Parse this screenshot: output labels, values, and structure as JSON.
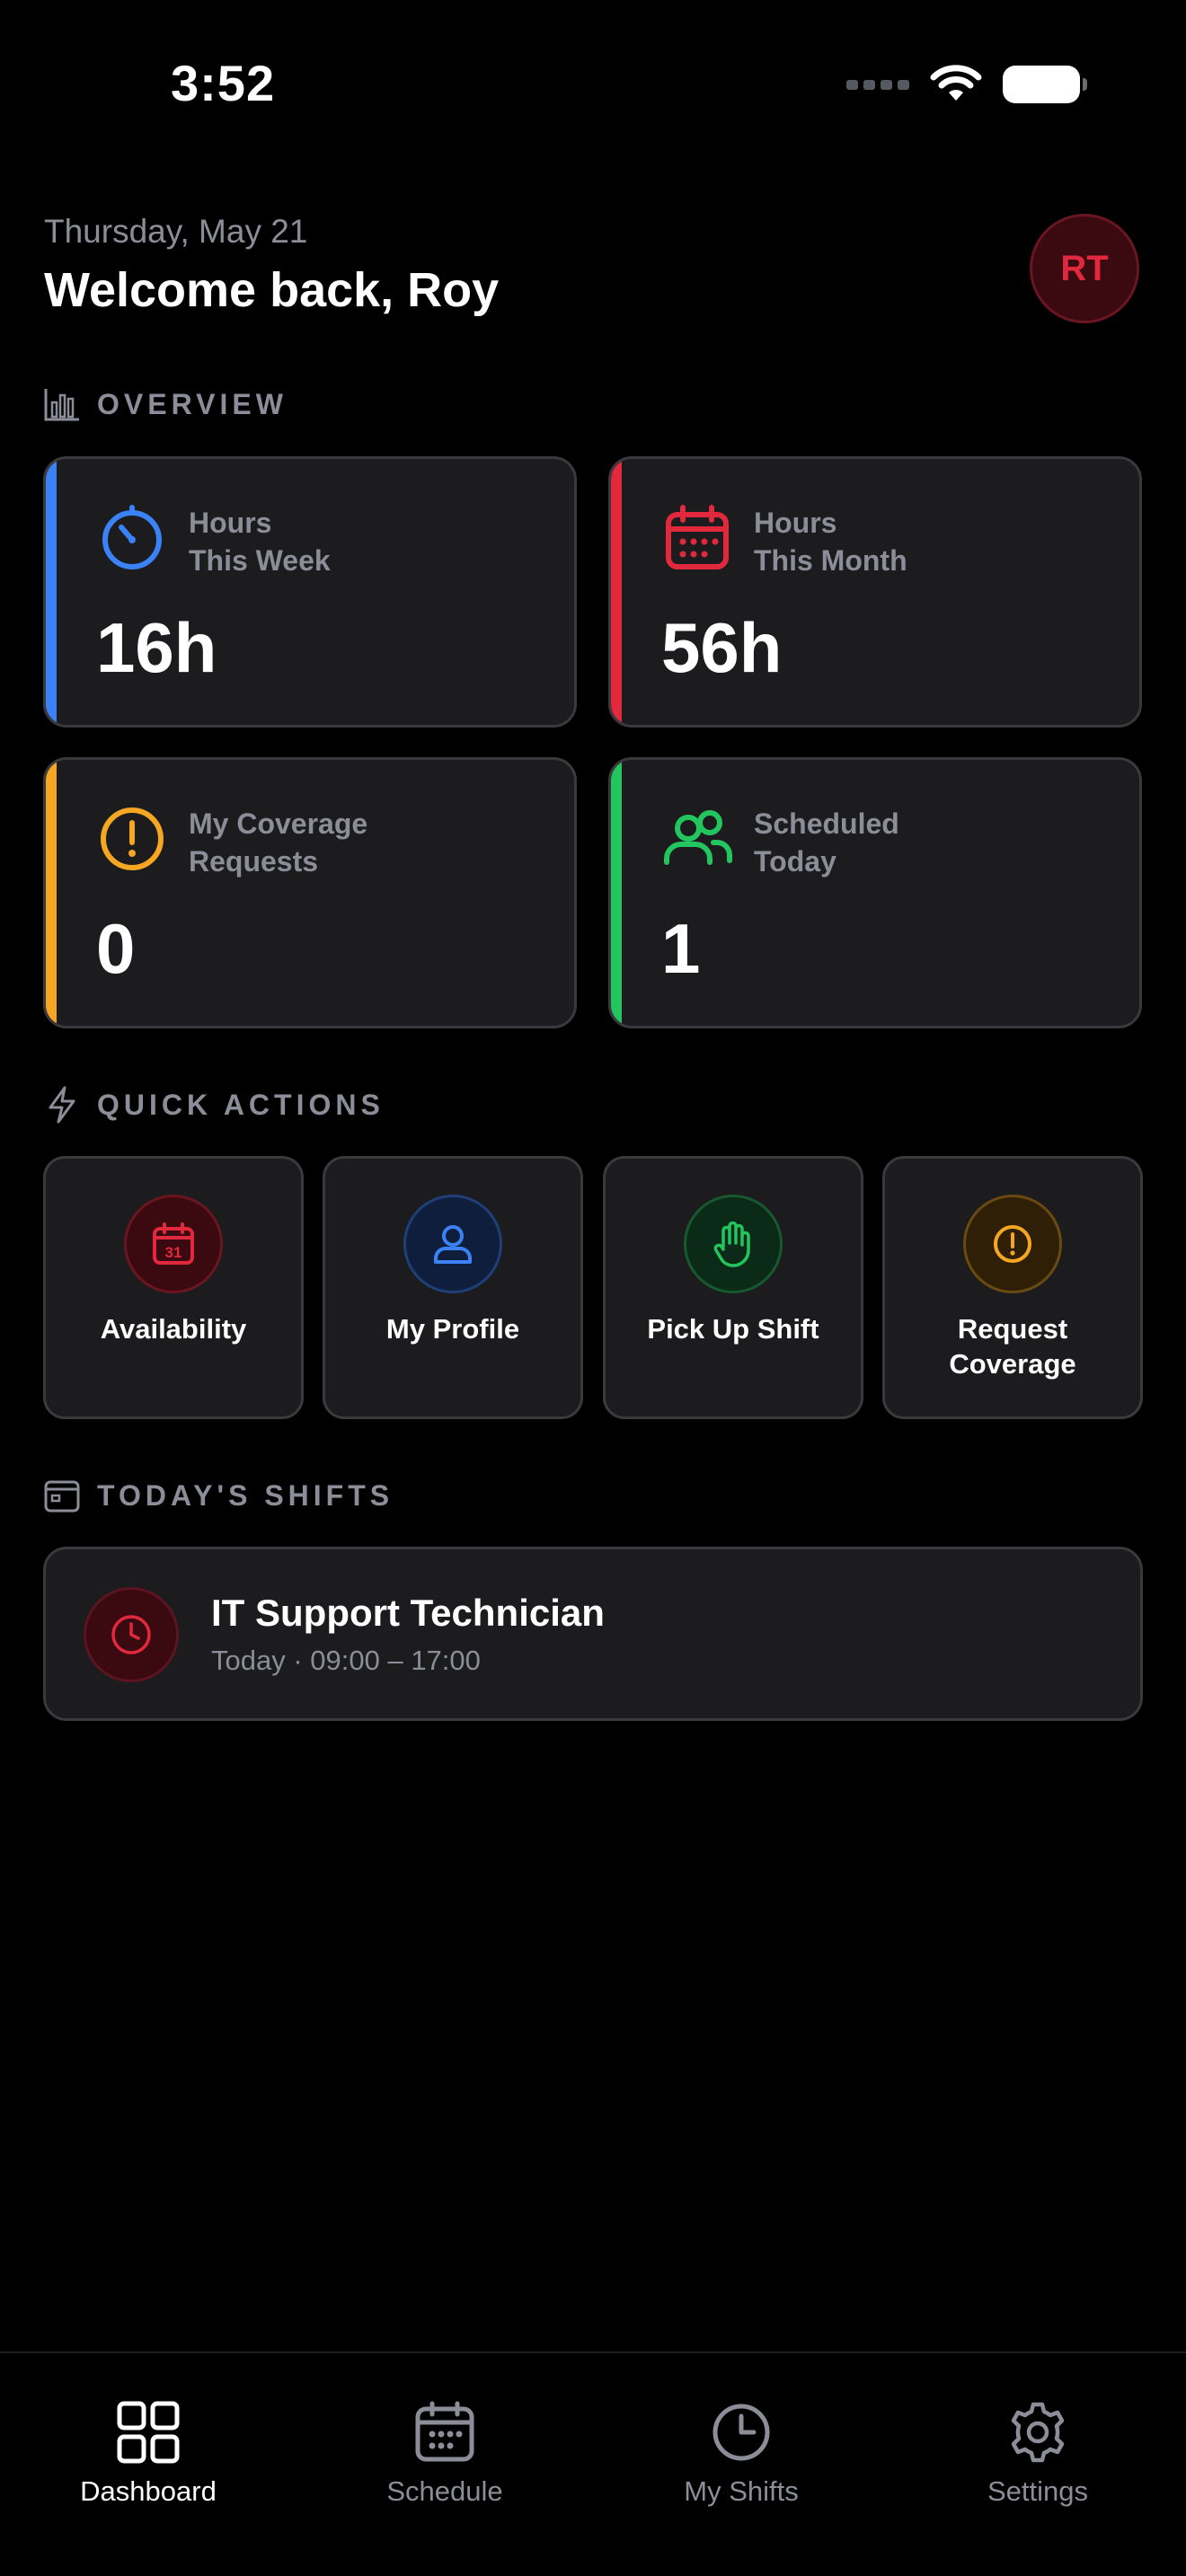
{
  "status_bar": {
    "time": "3:52"
  },
  "header": {
    "date": "Thursday, May 21",
    "welcome": "Welcome back, Roy",
    "avatar_initials": "RT"
  },
  "overview": {
    "title": "OVERVIEW",
    "cards": [
      {
        "label_line1": "Hours",
        "label_line2": "This Week",
        "value": "16h",
        "accent": "#3b82f6",
        "icon": "timer-icon"
      },
      {
        "label_line1": "Hours",
        "label_line2": "This Month",
        "value": "56h",
        "accent": "#e2283d",
        "icon": "calendar-grid-icon"
      },
      {
        "label_line1": "My Coverage",
        "label_line2": "Requests",
        "value": "0",
        "accent": "#f5a623",
        "icon": "alert-circle-icon"
      },
      {
        "label_line1": "Scheduled",
        "label_line2": "Today",
        "value": "1",
        "accent": "#22c55e",
        "icon": "users-icon"
      }
    ]
  },
  "quick_actions": {
    "title": "QUICK ACTIONS",
    "items": [
      {
        "label": "Availability",
        "icon": "calendar-31-icon",
        "color": "#e2283d"
      },
      {
        "label": "My Profile",
        "icon": "user-icon",
        "color": "#3b82f6"
      },
      {
        "label": "Pick Up Shift",
        "icon": "hand-icon",
        "color": "#22c55e"
      },
      {
        "label": "Request Coverage",
        "icon": "alert-circle-icon",
        "color": "#f5a623"
      }
    ]
  },
  "todays_shifts": {
    "title": "TODAY'S SHIFTS",
    "shifts": [
      {
        "title": "IT Support Technician",
        "subtitle": "Today · 09:00 – 17:00",
        "icon": "clock-icon"
      }
    ]
  },
  "tab_bar": {
    "tabs": [
      {
        "label": "Dashboard",
        "icon": "grid-icon",
        "active": true
      },
      {
        "label": "Schedule",
        "icon": "calendar-icon",
        "active": false
      },
      {
        "label": "My Shifts",
        "icon": "clock-icon",
        "active": false
      },
      {
        "label": "Settings",
        "icon": "gear-icon",
        "active": false
      }
    ]
  },
  "colors": {
    "background": "#000000",
    "card": "#1c1c1e",
    "card_border": "#3a3a3e",
    "muted_text": "#8b8e98",
    "brand_red": "#e2283d",
    "blue": "#3b82f6",
    "orange": "#f5a623",
    "green": "#22c55e"
  }
}
